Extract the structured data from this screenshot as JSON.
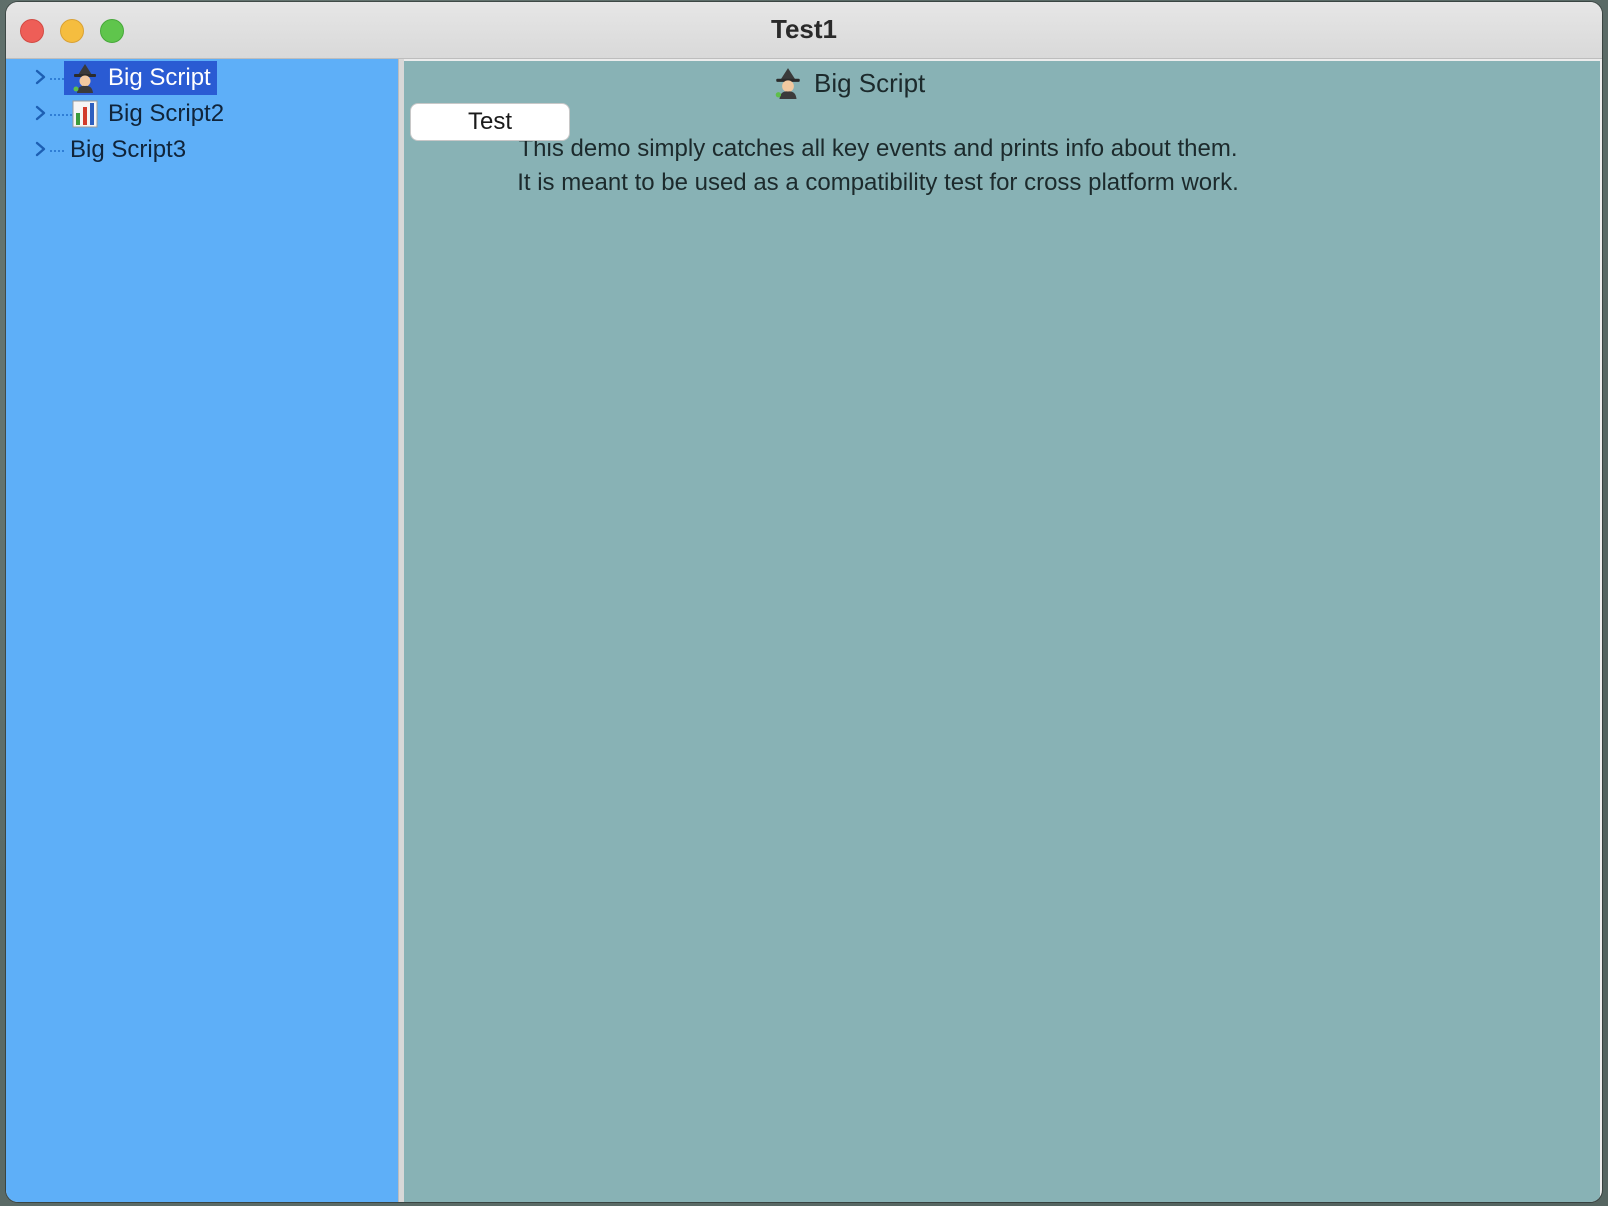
{
  "window": {
    "title": "Test1"
  },
  "sidebar": {
    "items": [
      {
        "label": "Big Script",
        "icon": "witch-icon",
        "selected": true
      },
      {
        "label": "Big Script2",
        "icon": "bar-chart-icon",
        "selected": false
      },
      {
        "label": "Big Script3",
        "icon": "",
        "selected": false
      }
    ]
  },
  "main": {
    "header": {
      "label": "Big Script",
      "icon": "witch-icon"
    },
    "button_label": "Test",
    "description_lines": [
      "This demo simply catches all key events and prints info about them.",
      "It is meant to be used as a compatibility test for cross platform work."
    ]
  },
  "colors": {
    "sidebar_bg": "#5eaff8",
    "selection_bg": "#2a5bd3",
    "content_bg": "#88b2b5"
  }
}
